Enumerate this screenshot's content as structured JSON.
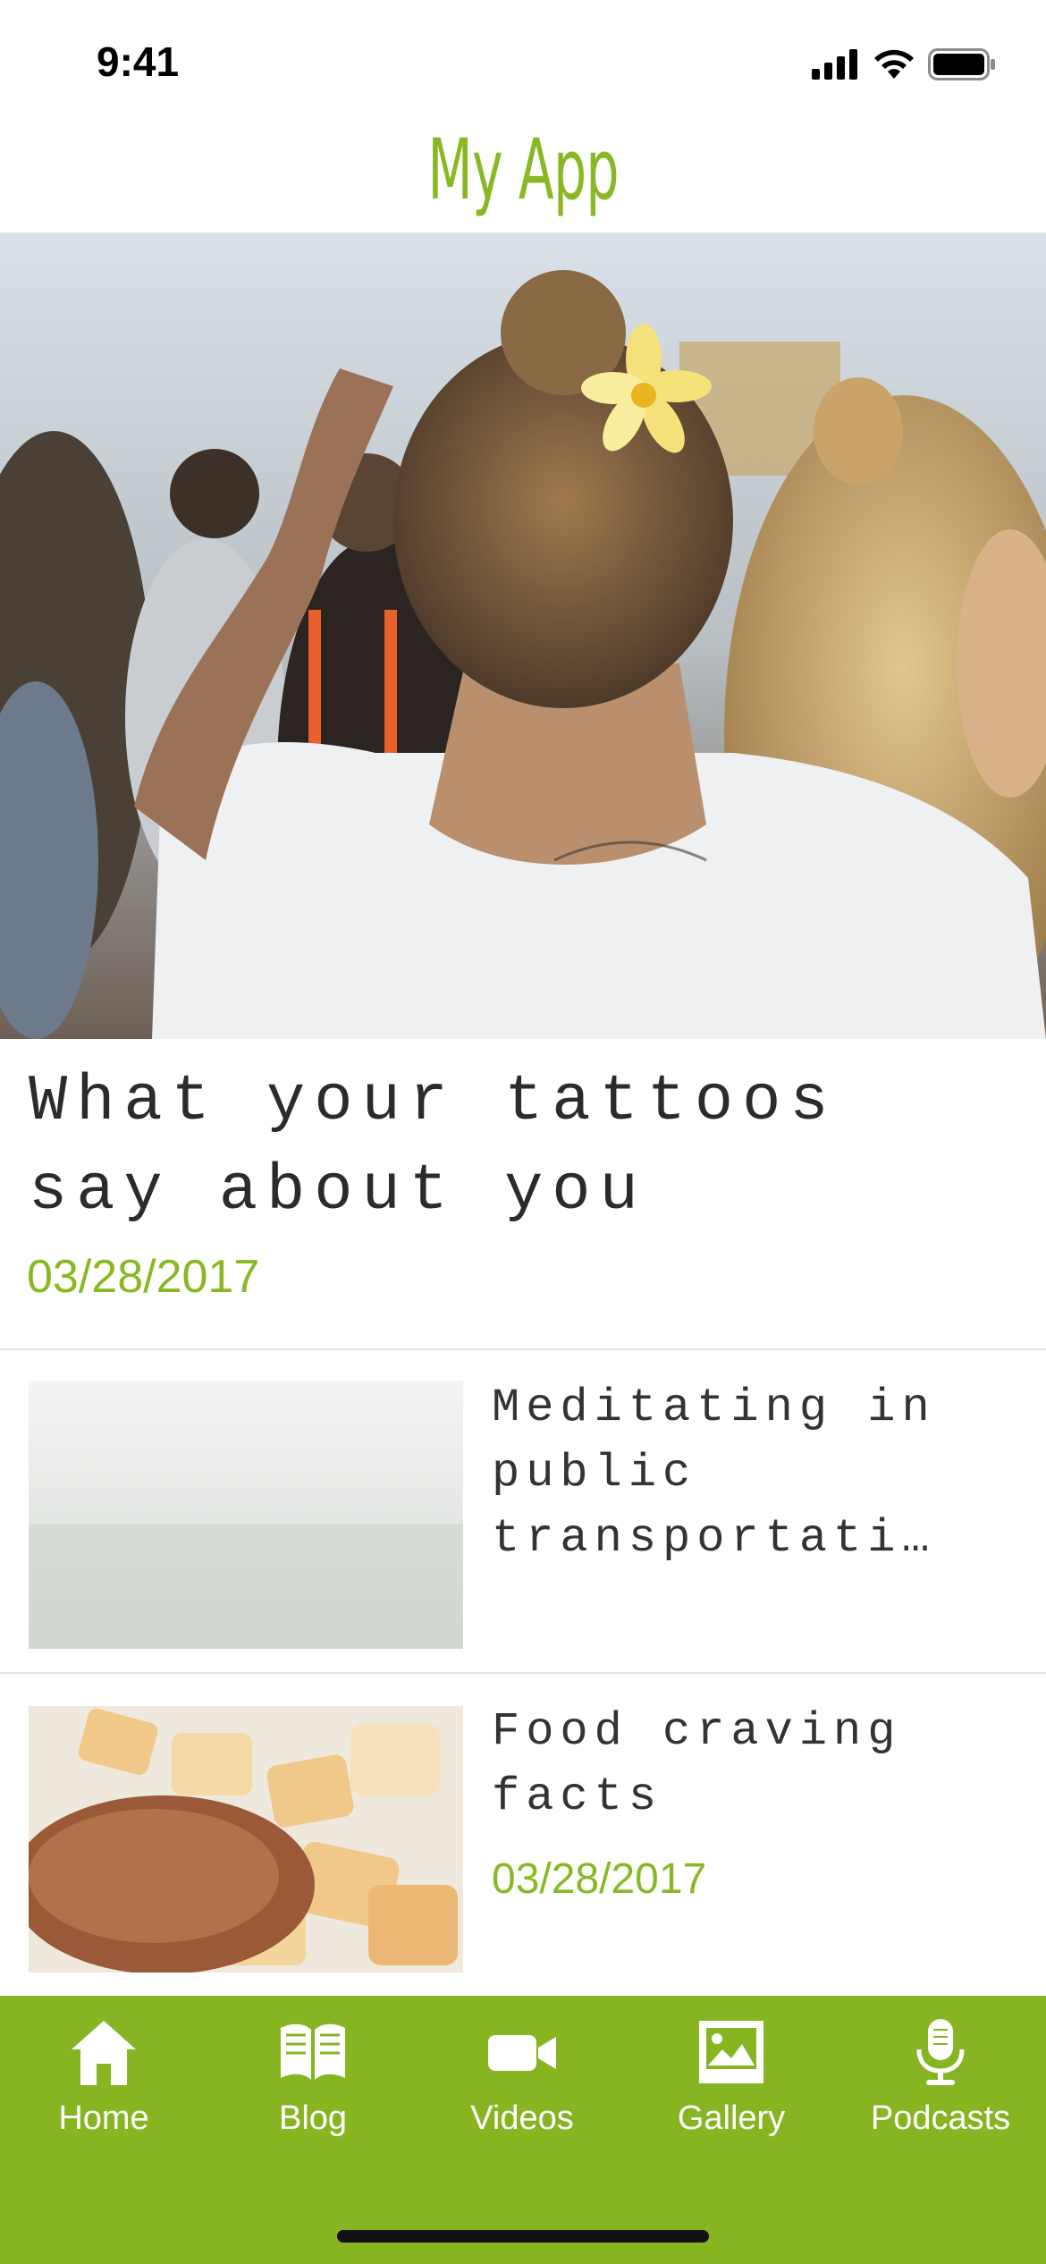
{
  "status_bar": {
    "time": "9:41"
  },
  "header": {
    "title": "My App"
  },
  "featured": {
    "title_line1": "What your tattoos",
    "title_line2": "say about you",
    "date": "03/28/2017"
  },
  "posts": [
    {
      "title_line1": "Meditating in",
      "title_line2": "public",
      "title_line3": "transportati…"
    },
    {
      "title_line1": "Food craving",
      "title_line2": "facts",
      "date": "03/28/2017"
    }
  ],
  "tabs": [
    {
      "label": "Home",
      "icon": "home-icon"
    },
    {
      "label": "Blog",
      "icon": "book-icon"
    },
    {
      "label": "Videos",
      "icon": "video-camera-icon"
    },
    {
      "label": "Gallery",
      "icon": "picture-icon"
    },
    {
      "label": "Podcasts",
      "icon": "microphone-icon"
    }
  ],
  "colors": {
    "accent": "#8ab825",
    "tabbar": "#87b521"
  }
}
